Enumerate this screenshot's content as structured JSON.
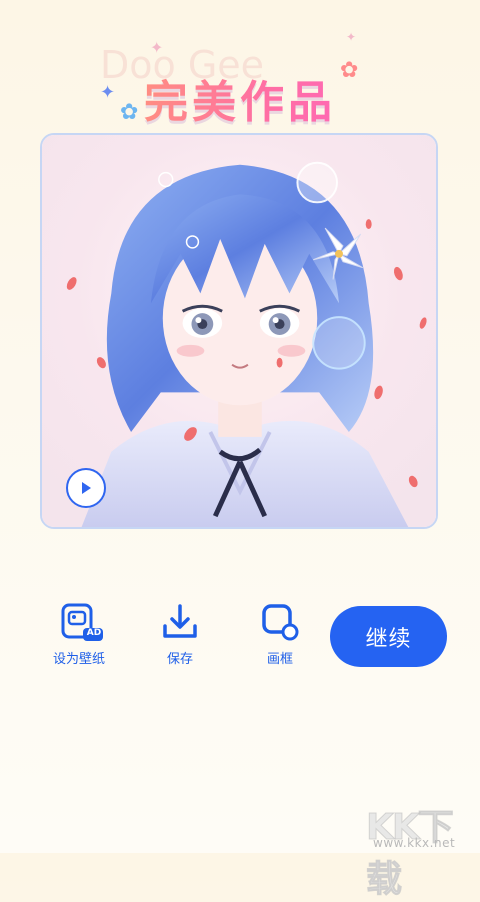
{
  "header": {
    "title": "完美作品"
  },
  "artwork": {
    "play_icon": "play-icon"
  },
  "actions": [
    {
      "label": "设为壁纸",
      "icon": "wallpaper-ad-icon",
      "badge": "AD"
    },
    {
      "label": "保存",
      "icon": "download-icon"
    },
    {
      "label": "画框",
      "icon": "frame-icon"
    }
  ],
  "continue_label": "继续",
  "watermark": {
    "text": "KK下载",
    "url": "www.kkx.net"
  },
  "colors": {
    "accent": "#2563f2",
    "action_text": "#1f5fe8",
    "title_from": "#ffb15a",
    "title_to": "#ff5fd0",
    "card_border": "#c6d6f4"
  }
}
